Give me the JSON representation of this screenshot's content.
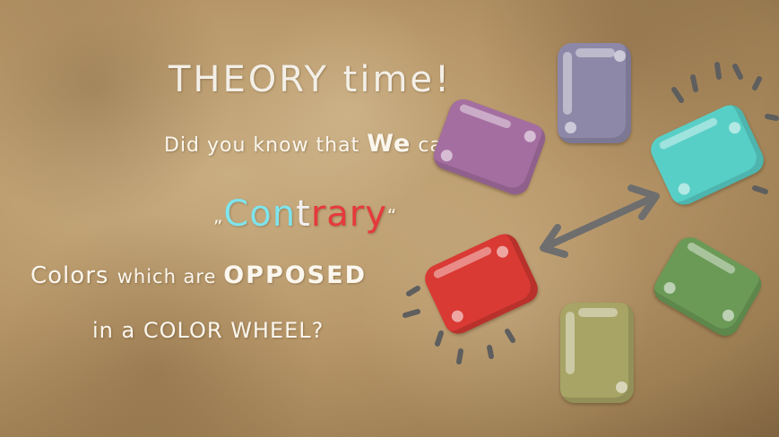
{
  "slide": {
    "title": "THEORY time!",
    "line1_a": "Did you know that ",
    "line1_b": "We",
    "line1_c": " call",
    "term_open": "„",
    "term_a": "Con",
    "term_b": "t",
    "term_c": "rary",
    "term_close": "“",
    "line3_a": "Colors ",
    "line3_b": "which are ",
    "line3_c": "OPPOSED",
    "line4": "in a COLOR WHEEL?"
  },
  "color_wheel": {
    "swatches": [
      {
        "name": "purple",
        "color": "#8e88a8"
      },
      {
        "name": "violet",
        "color": "#a46ea0"
      },
      {
        "name": "turquoise",
        "color": "#58cfc6"
      },
      {
        "name": "red",
        "color": "#d93a33"
      },
      {
        "name": "green",
        "color": "#6b9a57"
      },
      {
        "name": "yellow",
        "color": "#a7a465"
      }
    ],
    "arrow_color": "#6e6e6e",
    "accent_marks_color": "#5e5e5e"
  }
}
